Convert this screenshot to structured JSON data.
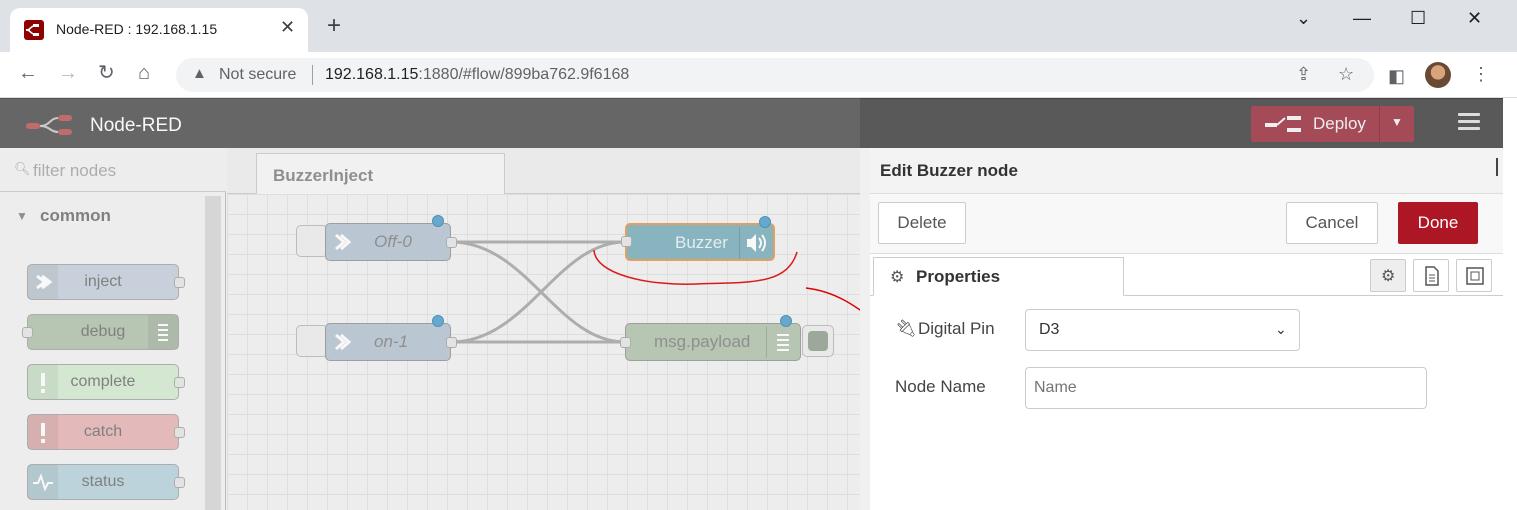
{
  "browser": {
    "tab_title": "Node-RED : 192.168.1.15",
    "tab_close": "✕",
    "new_tab": "+",
    "window_controls": [
      "⌄",
      "—",
      "☐",
      "✕"
    ],
    "nav": {
      "back": "←",
      "forward": "→",
      "reload": "↻",
      "home": "⌂"
    },
    "security_icon": "warning-triangle-icon",
    "security_label": "Not secure",
    "url_host": "192.168.1.15",
    "url_rest": ":1880/#flow/899ba762.9f6168"
  },
  "header": {
    "title": "Node-RED",
    "deploy_label": "Deploy",
    "deploy_color": "#a54a57"
  },
  "palette": {
    "filter_placeholder": "filter nodes",
    "category": "common",
    "nodes": [
      {
        "label": "inject",
        "color": "#a6bbcf"
      },
      {
        "label": "debug",
        "color": "#87a980"
      },
      {
        "label": "complete",
        "color": "#c0edc0"
      },
      {
        "label": "catch",
        "color": "#e49191"
      },
      {
        "label": "status",
        "color": "#94c1d0"
      }
    ]
  },
  "flow": {
    "tab_label": "BuzzerInject",
    "nodes": [
      {
        "label": "Off-0"
      },
      {
        "label": "on-1"
      },
      {
        "label": "Buzzer"
      },
      {
        "label": "msg.payload"
      }
    ]
  },
  "tray": {
    "title": "Edit Buzzer node",
    "delete_label": "Delete",
    "cancel_label": "Cancel",
    "done_label": "Done",
    "tab_label": "Properties",
    "fields": {
      "pin_label": "Digital Pin",
      "pin_value": "D3",
      "name_label": "Node Name",
      "name_placeholder": "Name",
      "name_value": ""
    }
  }
}
